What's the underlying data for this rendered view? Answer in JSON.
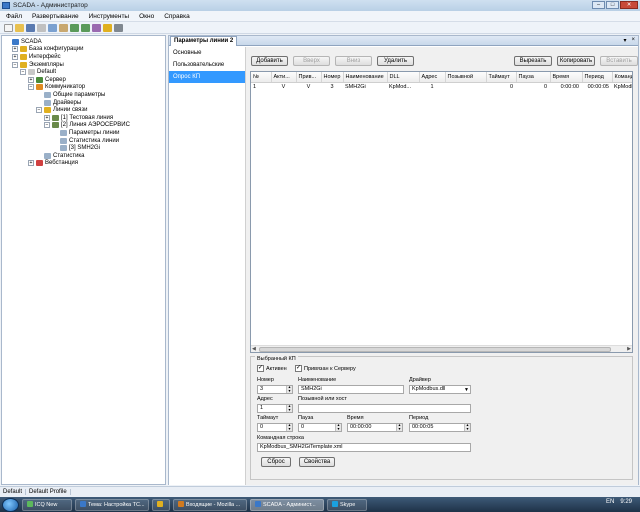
{
  "window": {
    "title": "SCADA - Администратор"
  },
  "menu": [
    "Файл",
    "Развертывание",
    "Инструменты",
    "Окно",
    "Справка"
  ],
  "toolbar_icons": [
    "new-icon",
    "open-icon",
    "save-icon",
    "cut-icon",
    "copy-icon",
    "paste-icon",
    "undo-icon",
    "redo-icon",
    "tool-icon",
    "folder-icon",
    "settings-icon"
  ],
  "tree": [
    {
      "label": "SCADA",
      "depth": 0,
      "expander": "",
      "icon": "scada-icon",
      "color": "#3a78c8"
    },
    {
      "label": "База конфигурации",
      "depth": 1,
      "expander": "+",
      "icon": "database-icon",
      "color": "#e0b020"
    },
    {
      "label": "Интерфейс",
      "depth": 1,
      "expander": "+",
      "icon": "folder-icon",
      "color": "#e0b020"
    },
    {
      "label": "Экземпляры",
      "depth": 1,
      "expander": "−",
      "icon": "folder-icon",
      "color": "#e0b020"
    },
    {
      "label": "Default",
      "depth": 2,
      "expander": "−",
      "icon": "instance-icon",
      "color": "#c8c8c8"
    },
    {
      "label": "Сервер",
      "depth": 3,
      "expander": "+",
      "icon": "server-icon",
      "color": "#4a8a3a"
    },
    {
      "label": "Коммуникатор",
      "depth": 3,
      "expander": "−",
      "icon": "communicator-icon",
      "color": "#e08a20"
    },
    {
      "label": "Общие параметры",
      "depth": 4,
      "expander": "",
      "icon": "params-icon",
      "color": "#9ab0c8"
    },
    {
      "label": "Драйверы",
      "depth": 4,
      "expander": "",
      "icon": "drivers-icon",
      "color": "#9ab0c8"
    },
    {
      "label": "Линии связи",
      "depth": 4,
      "expander": "−",
      "icon": "lines-icon",
      "color": "#e0b020"
    },
    {
      "label": "[1] Тестовая линия",
      "depth": 5,
      "expander": "+",
      "icon": "line-icon",
      "color": "#6a8a4a"
    },
    {
      "label": "[2] Линия АЭРОСЕРВИС",
      "depth": 5,
      "expander": "−",
      "icon": "line-icon",
      "color": "#6a8a4a"
    },
    {
      "label": "Параметры линии",
      "depth": 6,
      "expander": "",
      "icon": "params-icon",
      "color": "#9ab0c8"
    },
    {
      "label": "Статистика линии",
      "depth": 6,
      "expander": "",
      "icon": "stats-icon",
      "color": "#9ab0c8"
    },
    {
      "label": "[3] SMH2Gi",
      "depth": 6,
      "expander": "",
      "icon": "device-icon",
      "color": "#9ab0c8"
    },
    {
      "label": "Статистика",
      "depth": 4,
      "expander": "",
      "icon": "stats-icon",
      "color": "#9ab0c8"
    },
    {
      "label": "Вебстанция",
      "depth": 3,
      "expander": "+",
      "icon": "web-icon",
      "color": "#d04040"
    }
  ],
  "tab": {
    "title": "Параметры линии 2",
    "pin": "▾",
    "close": "×"
  },
  "sidenav": [
    {
      "label": "Основные",
      "active": false
    },
    {
      "label": "Пользовательские",
      "active": false
    },
    {
      "label": "Опрос КП",
      "active": true
    }
  ],
  "buttons": {
    "add": "Добавить",
    "up": "Вверх",
    "down": "Вниз",
    "delete": "Удалить",
    "cut": "Вырезать",
    "copy": "Копировать",
    "paste": "Вставить"
  },
  "grid": {
    "headers": [
      "№",
      "Акти...",
      "Прив...",
      "Номер",
      "Наименование",
      "DLL",
      "Адрес",
      "Позывной",
      "Таймаут",
      "Пауза",
      "Время",
      "Период",
      "Команд"
    ],
    "rows": [
      [
        "1",
        "V",
        "V",
        "3",
        "SMH2Gi",
        "KpMod...",
        "1",
        "",
        "0",
        "0",
        "0:00:00",
        "00:00:05",
        "KpModb"
      ]
    ]
  },
  "selected": {
    "legend": "Выбранный КП",
    "active_label": "Активен",
    "bound_label": "Привязан к Серверу",
    "number_label": "Номер",
    "number_value": "3",
    "name_label": "Наименование",
    "name_value": "SMH2Gi",
    "driver_label": "Драйвер",
    "driver_value": "KpModbus.dll",
    "address_label": "Адрес",
    "address_value": "1",
    "callsign_label": "Позывной или хост",
    "callsign_value": "",
    "timeout_label": "Таймаут",
    "timeout_value": "0",
    "pause_label": "Пауза",
    "pause_value": "0",
    "time_label": "Время",
    "time_value": "00:00:00",
    "period_label": "Период",
    "period_value": "00:00:05",
    "cmdline_label": "Командная строка",
    "cmdline_value": "KpModbus_SMH2GiTemplate.xml",
    "reset_button": "Сброс",
    "props_button": "Свойства"
  },
  "status": [
    "Default",
    "Default Profile"
  ],
  "taskbar": {
    "items": [
      {
        "label": "ICQ New",
        "color": "#5cb85c"
      },
      {
        "label": "Тема: Настройка ТС...",
        "color": "#3a78c8"
      },
      {
        "label": "",
        "color": "#e0b020"
      },
      {
        "label": "Входящие - Mozilla ...",
        "color": "#d07a20"
      },
      {
        "label": "SCADA - Админист...",
        "color": "#3a78c8",
        "active": true
      },
      {
        "label": "Skype",
        "color": "#1aa0e0"
      }
    ],
    "lang": "EN",
    "clock": "9:29"
  }
}
